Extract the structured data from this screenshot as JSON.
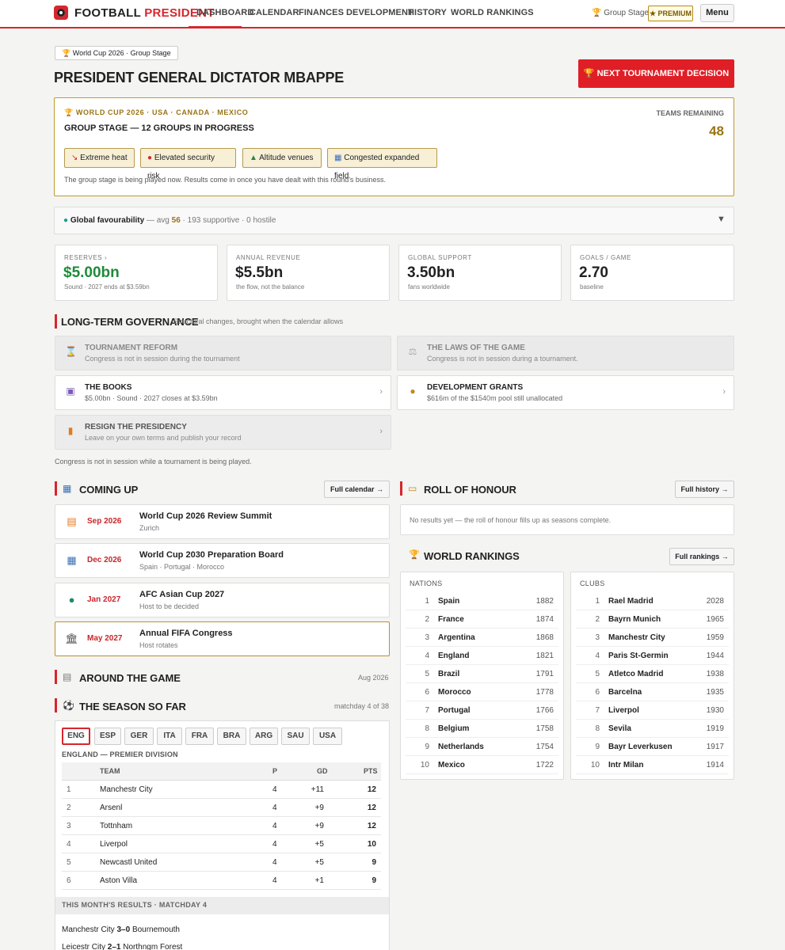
{
  "nav": {
    "brand_a": "FOOTBALL",
    "brand_b": "PRESIDENT",
    "links": [
      "DASHBOARD",
      "CALENDAR",
      "FINANCES",
      "DEVELOPMENT",
      "HISTORY",
      "WORLD RANKINGS"
    ],
    "stage": "Group Stage",
    "premium": "★ PREMIUM",
    "menu": "Menu"
  },
  "header": {
    "pill": "World Cup 2026 · Group Stage",
    "title": "PRESIDENT GENERAL DICTATOR MBAPPE",
    "next_button": "NEXT TOURNAMENT DECISION"
  },
  "tournament": {
    "subtitle": "WORLD CUP 2026 · USA · CANADA · MEXICO",
    "status": "GROUP STAGE — 12 GROUPS IN PROGRESS",
    "teams_label": "TEAMS REMAINING",
    "teams_value": "48",
    "chips": [
      "Extreme heat",
      "Elevated security risk",
      "Altitude venues",
      "Congested expanded field"
    ],
    "note": "The group stage is being played now. Results come in once you have dealt with this round's business."
  },
  "favourability": {
    "label": "Global favourability",
    "dash": " — avg ",
    "avg": "56",
    "rest": " · 193 supportive · 0 hostile"
  },
  "stats": [
    {
      "label": "RESERVES ›",
      "value": "$5.00bn",
      "sub": "Sound · 2027 ends at $3.59bn",
      "color": "#1f8a3b"
    },
    {
      "label": "ANNUAL REVENUE",
      "value": "$5.5bn",
      "sub": "the flow, not the balance",
      "color": "#222"
    },
    {
      "label": "GLOBAL SUPPORT",
      "value": "3.50bn",
      "sub": "fans worldwide",
      "color": "#222"
    },
    {
      "label": "GOALS / GAME",
      "value": "2.70",
      "sub": "baseline",
      "color": "#222"
    }
  ],
  "governance": {
    "title": "LONG-TERM GOVERNANCE",
    "subtitle": "Structural changes, brought when the calendar allows",
    "cards": [
      {
        "title": "TOURNAMENT REFORM",
        "sub": "Congress is not in session during the tournament"
      },
      {
        "title": "THE LAWS OF THE GAME",
        "sub": "Congress is not in session during a tournament."
      },
      {
        "title": "THE BOOKS",
        "sub": "$5.00bn · Sound · 2027 closes at $3.59bn"
      },
      {
        "title": "DEVELOPMENT GRANTS",
        "sub": "$616m of the $1540m pool still unallocated"
      },
      {
        "title": "RESIGN THE PRESIDENCY",
        "sub": "Leave on your own terms and publish your record"
      }
    ],
    "footer": "Congress is not in session while a tournament is being played."
  },
  "coming_up": {
    "title": "COMING UP",
    "button": "Full calendar →",
    "events": [
      {
        "date": "Sep 2026",
        "name": "World Cup 2026 Review Summit",
        "loc": "Zurich"
      },
      {
        "date": "Dec 2026",
        "name": "World Cup 2030 Preparation Board",
        "loc": "Spain · Portugal · Morocco"
      },
      {
        "date": "Jan 2027",
        "name": "AFC Asian Cup 2027",
        "loc": "Host to be decided"
      },
      {
        "date": "May 2027",
        "name": "Annual FIFA Congress",
        "loc": "Host rotates"
      }
    ]
  },
  "roll": {
    "title": "ROLL OF HONOUR",
    "button": "Full history →",
    "empty": "No results yet — the roll of honour fills up as seasons complete."
  },
  "rankings": {
    "title": "WORLD RANKINGS",
    "button": "Full rankings →",
    "nations_label": "NATIONS",
    "clubs_label": "CLUBS",
    "nations": [
      {
        "rank": "1",
        "name": "Spain",
        "score": "1882"
      },
      {
        "rank": "2",
        "name": "France",
        "score": "1874"
      },
      {
        "rank": "3",
        "name": "Argentina",
        "score": "1868"
      },
      {
        "rank": "4",
        "name": "England",
        "score": "1821"
      },
      {
        "rank": "5",
        "name": "Brazil",
        "score": "1791"
      },
      {
        "rank": "6",
        "name": "Morocco",
        "score": "1778"
      },
      {
        "rank": "7",
        "name": "Portugal",
        "score": "1766"
      },
      {
        "rank": "8",
        "name": "Belgium",
        "score": "1758"
      },
      {
        "rank": "9",
        "name": "Netherlands",
        "score": "1754"
      },
      {
        "rank": "10",
        "name": "Mexico",
        "score": "1722"
      }
    ],
    "clubs": [
      {
        "rank": "1",
        "name": "Rael Madrid",
        "score": "2028"
      },
      {
        "rank": "2",
        "name": "Bayrn Munich",
        "score": "1965"
      },
      {
        "rank": "3",
        "name": "Manchestr City",
        "score": "1959"
      },
      {
        "rank": "4",
        "name": "Paris St-Germin",
        "score": "1944"
      },
      {
        "rank": "5",
        "name": "Atletco Madrid",
        "score": "1938"
      },
      {
        "rank": "6",
        "name": "Barcelna",
        "score": "1935"
      },
      {
        "rank": "7",
        "name": "Liverpol",
        "score": "1930"
      },
      {
        "rank": "8",
        "name": "Sevila",
        "score": "1919"
      },
      {
        "rank": "9",
        "name": "Bayr Leverkusen",
        "score": "1917"
      },
      {
        "rank": "10",
        "name": "Intr Milan",
        "score": "1914"
      }
    ]
  },
  "around": {
    "title": "AROUND THE GAME",
    "date": "Aug 2026"
  },
  "season": {
    "title": "THE SEASON SO FAR",
    "matchday": "matchday 4 of 38",
    "tabs": [
      "ENG",
      "ESP",
      "GER",
      "ITA",
      "FRA",
      "BRA",
      "ARG",
      "SAU",
      "USA"
    ],
    "league": "ENGLAND — PREMIER DIVISION",
    "cols": {
      "team": "TEAM",
      "p": "P",
      "gd": "GD",
      "pts": "PTS"
    },
    "table": [
      {
        "pos": "1",
        "team": "Manchestr City",
        "p": "4",
        "gd": "+11",
        "pts": "12"
      },
      {
        "pos": "2",
        "team": "Arsenl",
        "p": "4",
        "gd": "+9",
        "pts": "12"
      },
      {
        "pos": "3",
        "team": "Tottnham",
        "p": "4",
        "gd": "+9",
        "pts": "12"
      },
      {
        "pos": "4",
        "team": "Liverpol",
        "p": "4",
        "gd": "+5",
        "pts": "10"
      },
      {
        "pos": "5",
        "team": "Newcastl United",
        "p": "4",
        "gd": "+5",
        "pts": "9"
      },
      {
        "pos": "6",
        "team": "Aston Villa",
        "p": "4",
        "gd": "+1",
        "pts": "9"
      }
    ],
    "results_label": "THIS MONTH'S RESULTS · MATCHDAY 4",
    "results": [
      {
        "home": "Manchestr City",
        "score": "3–0",
        "away": "Bournemouth"
      },
      {
        "home": "Leicestr City",
        "score": "2–1",
        "away": "Northngm Forest"
      }
    ]
  }
}
